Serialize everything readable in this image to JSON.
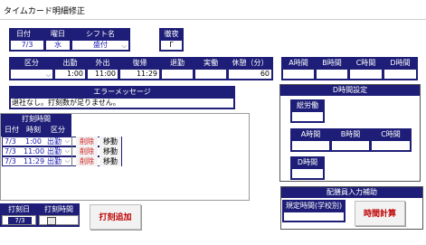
{
  "window": {
    "title": "タイムカード明細修正"
  },
  "header_fields": {
    "date_label": "日付",
    "date_value": "7/3",
    "weekday_label": "曜日",
    "weekday_value": "水",
    "shift_label": "シフト名",
    "shift_value": "盛付",
    "night_label": "徹夜",
    "night_checkbox": "Γ"
  },
  "time_row": {
    "headers": [
      "区分",
      "出勤",
      "外出",
      "復帰",
      "退勤",
      "実働",
      "休憩（分）"
    ],
    "values": [
      "",
      "1:00",
      "11:00",
      "11:29",
      "",
      "",
      "60"
    ]
  },
  "abcd_top": {
    "headers": [
      "A時間",
      "B時間",
      "C時間",
      "D時間"
    ]
  },
  "error_message": {
    "header": "エラーメッセージ",
    "text": "退社なし。打刻数が足りません。"
  },
  "dtime_panel": {
    "title": "D時間設定",
    "total_label": "総労働",
    "headers": [
      "A時間",
      "B時間",
      "C時間"
    ],
    "d_label": "D時間"
  },
  "punch_list": {
    "title": "打刻時間",
    "headers": [
      "日付",
      "時刻",
      "区分"
    ],
    "rows": [
      {
        "date": "7/3",
        "time": "1:00",
        "kind": "出勤",
        "delete": "削除",
        "move": "移動"
      },
      {
        "date": "7/3",
        "time": "11:00",
        "kind": "出勤",
        "delete": "削除",
        "move": "移動"
      },
      {
        "date": "7/3",
        "time": "11:29",
        "kind": "出勤",
        "delete": "削除",
        "move": "移動"
      }
    ]
  },
  "add_section": {
    "date_label": "打刻日",
    "date_value": "7/3",
    "time_label": "打刻時間",
    "add_button": "打刻追加"
  },
  "dist_panel": {
    "title": "配膳員入力補助",
    "field_label": "規定時間(学校別)",
    "calc_button": "時間計算"
  }
}
